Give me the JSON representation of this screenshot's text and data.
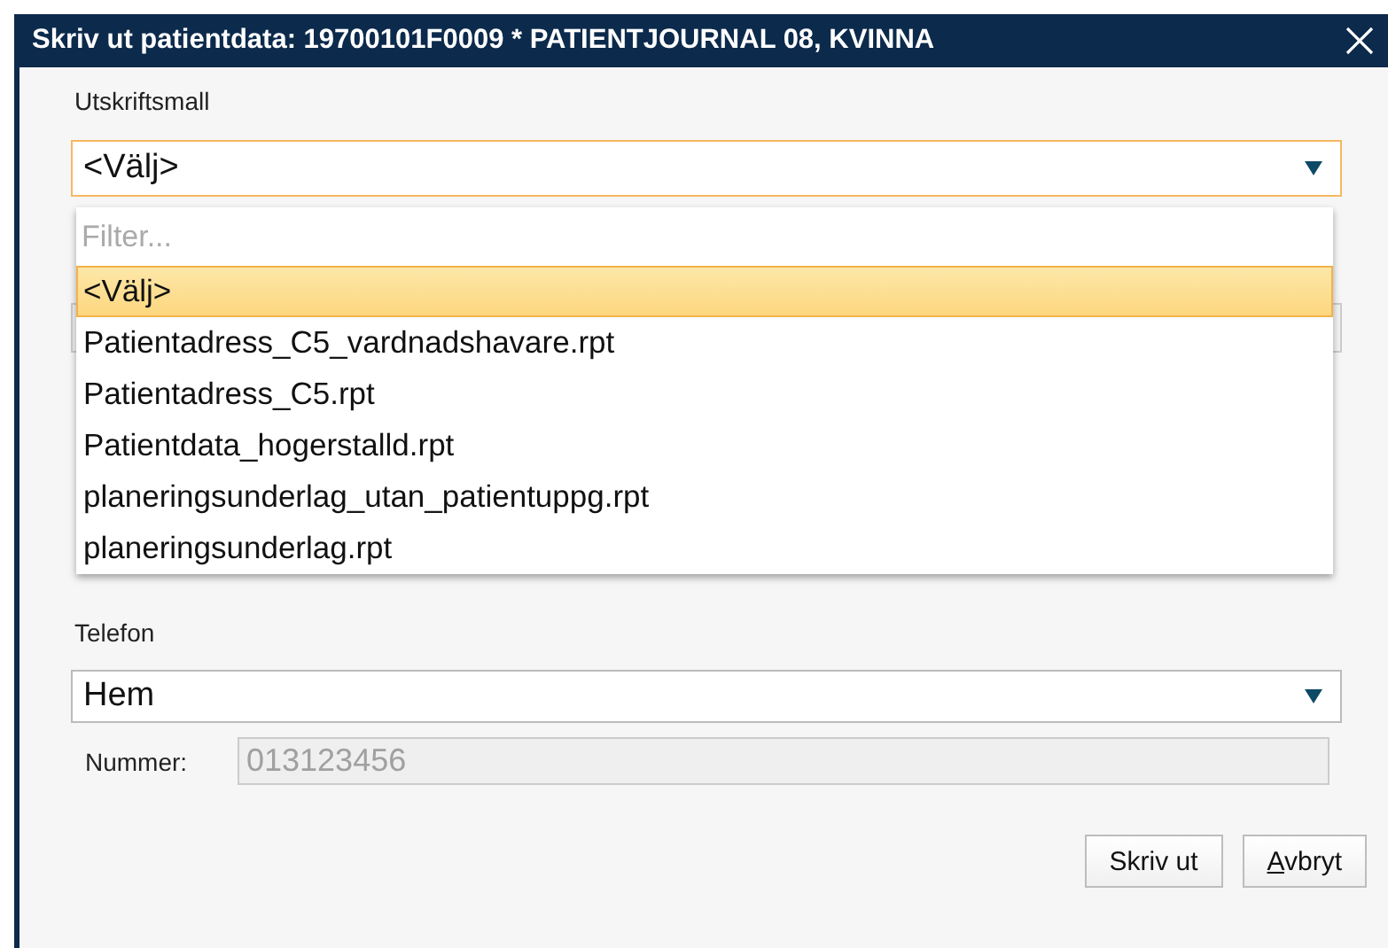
{
  "window": {
    "title": "Skriv ut patientdata: 19700101F0009 * PATIENTJOURNAL 08, KVINNA"
  },
  "template_field": {
    "label": "Utskriftsmall",
    "value": "<Välj>",
    "expanded": true,
    "filter_placeholder": "Filter...",
    "options": [
      {
        "label": "<Välj>",
        "selected": true
      },
      {
        "label": "Patientadress_C5_vardnadshavare.rpt",
        "selected": false
      },
      {
        "label": "Patientadress_C5.rpt",
        "selected": false
      },
      {
        "label": "Patientdata_hogerstalld.rpt",
        "selected": false
      },
      {
        "label": "planeringsunderlag_utan_patientuppg.rpt",
        "selected": false
      },
      {
        "label": "planeringsunderlag.rpt",
        "selected": false
      }
    ]
  },
  "phone": {
    "label": "Telefon",
    "value": "Hem",
    "expanded": false,
    "number_label": "Nummer:",
    "number": "013123456",
    "number_disabled": true
  },
  "buttons": [
    {
      "label": "Skriv ut",
      "mnemonic": false
    },
    {
      "label": "Avbryt",
      "mnemonic": true
    }
  ]
}
